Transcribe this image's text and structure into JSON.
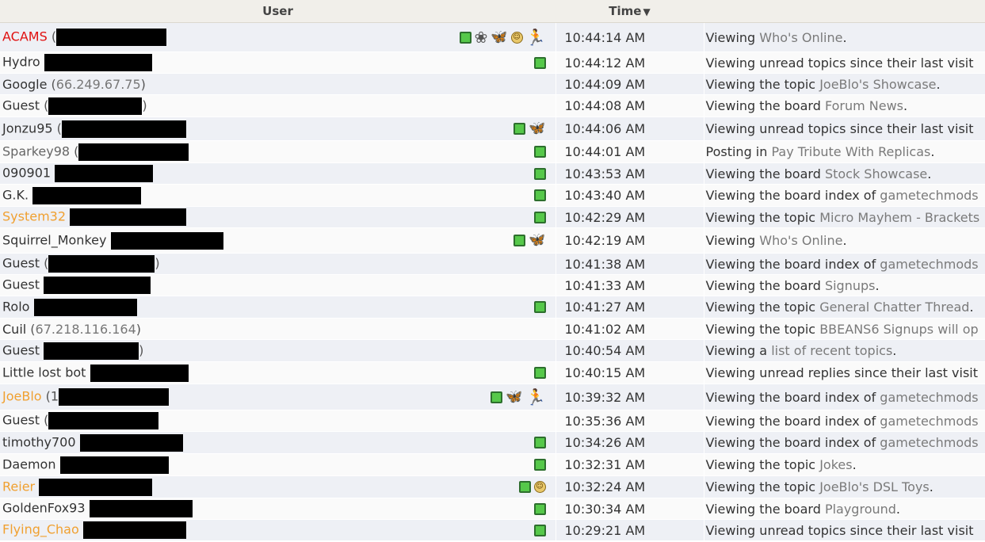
{
  "header": {
    "user": "User",
    "time": "Time",
    "sort_arrow": "▼"
  },
  "rows": [
    {
      "name": "ACAMS",
      "role": "admin",
      "paren": "(",
      "ip": "",
      "close": "",
      "redact_w": 139,
      "icons": [
        "online",
        "flower",
        "butterfly",
        "smile",
        "aim"
      ],
      "time": "10:44:14 AM",
      "verb": "Viewing ",
      "link": "Who's Online",
      "tail": ".",
      "h": 37
    },
    {
      "name": "Hydro",
      "role": "",
      "paren": "",
      "ip": "",
      "close": "",
      "redact_w": 136,
      "icons": [
        "online"
      ],
      "time": "10:44:12 AM",
      "verb": "Viewing unread topics since their last visit",
      "link": "",
      "tail": "",
      "h": 27
    },
    {
      "name": "Google",
      "role": "",
      "paren": "(",
      "ip": "66.249.67.75",
      "close": ")",
      "redact_w": 0,
      "icons": [],
      "time": "10:44:09 AM",
      "verb": "Viewing the topic ",
      "link": "JoeBlo's Showcase",
      "tail": ".",
      "h": 27
    },
    {
      "name": "Guest",
      "role": "",
      "paren": "(",
      "ip": "",
      "close": ")",
      "redact_w": 118,
      "icons": [],
      "time": "10:44:08 AM",
      "verb": "Viewing the board ",
      "link": "Forum News",
      "tail": ".",
      "h": 28
    },
    {
      "name": "Jonzu95",
      "role": "",
      "paren": "(",
      "ip": "",
      "close": "",
      "redact_w": 157,
      "icons": [
        "online",
        "butterfly"
      ],
      "time": "10:44:06 AM",
      "verb": "Viewing unread topics since their last visit",
      "link": "",
      "tail": "",
      "h": 30
    },
    {
      "name": "Sparkey98",
      "role": "muted",
      "paren": "(",
      "ip": "",
      "close": "",
      "redact_w": 139,
      "icons": [
        "online"
      ],
      "time": "10:44:01 AM",
      "verb": "Posting in ",
      "link": "Pay Tribute With Replicas",
      "tail": ".",
      "h": 28
    },
    {
      "name": "090901",
      "role": "",
      "paren": "",
      "ip": "",
      "close": "",
      "redact_w": 124,
      "icons": [
        "online"
      ],
      "time": "10:43:53 AM",
      "verb": "Viewing the board ",
      "link": "Stock Showcase",
      "tail": ".",
      "h": 27
    },
    {
      "name": "G.K.",
      "role": "",
      "paren": "",
      "ip": "",
      "close": "",
      "redact_w": 137,
      "icons": [
        "online"
      ],
      "time": "10:43:40 AM",
      "verb": "Viewing the board index of ",
      "link": "gametechmods",
      "tail": "",
      "h": 28
    },
    {
      "name": "System32",
      "role": "mod",
      "paren": "",
      "ip": "",
      "close": "",
      "redact_w": 147,
      "icons": [
        "online"
      ],
      "time": "10:42:29 AM",
      "verb": "Viewing the topic ",
      "link": "Micro Mayhem - Brackets",
      "tail": "",
      "h": 27
    },
    {
      "name": "Squirrel_Monkey",
      "role": "",
      "paren": "",
      "ip": "",
      "close": "",
      "redact_w": 142,
      "icons": [
        "online",
        "butterfly"
      ],
      "time": "10:42:19 AM",
      "verb": "Viewing ",
      "link": "Who's Online",
      "tail": ".",
      "h": 32
    },
    {
      "name": "Guest",
      "role": "",
      "paren": "(",
      "ip": "",
      "close": ")",
      "redact_w": 134,
      "icons": [],
      "time": "10:41:38 AM",
      "verb": "Viewing the board index of ",
      "link": "gametechmods",
      "tail": "",
      "h": 27
    },
    {
      "name": "Guest",
      "role": "",
      "paren": "",
      "ip": "",
      "close": "",
      "redact_w": 135,
      "icons": [],
      "time": "10:41:33 AM",
      "verb": "Viewing the board ",
      "link": "Signups",
      "tail": ".",
      "h": 27
    },
    {
      "name": "Rolo",
      "role": "",
      "paren": "",
      "ip": "",
      "close": "",
      "redact_w": 130,
      "icons": [
        "online"
      ],
      "time": "10:41:27 AM",
      "verb": "Viewing the topic ",
      "link": "General Chatter Thread",
      "tail": ".",
      "h": 28
    },
    {
      "name": "Cuil",
      "role": "",
      "paren": "(",
      "ip": "67.218.116.164",
      "close": ")",
      "redact_w": 0,
      "icons": [],
      "time": "10:41:02 AM",
      "verb": "Viewing the topic ",
      "link": "BBEANS6 Signups will op",
      "tail": "",
      "h": 27
    },
    {
      "name": "Guest",
      "role": "",
      "paren": "",
      "ip": "",
      "close": ")",
      "redact_w": 120,
      "icons": [],
      "time": "10:40:54 AM",
      "verb": "Viewing a ",
      "link": "list of recent topics",
      "tail": ".",
      "h": 28
    },
    {
      "name": "Little lost bot",
      "role": "",
      "paren": "",
      "ip": "",
      "close": "",
      "redact_w": 124,
      "icons": [
        "online"
      ],
      "time": "10:40:15 AM",
      "verb": "Viewing unread replies since their last visit",
      "link": "",
      "tail": "",
      "h": 28
    },
    {
      "name": "JoeBlo",
      "role": "mod",
      "paren": "(1",
      "ip": "",
      "close": "",
      "redact_w": 139,
      "icons": [
        "online",
        "butterfly",
        "aim"
      ],
      "time": "10:39:32 AM",
      "verb": "Viewing the board index of ",
      "link": "gametechmods",
      "tail": "",
      "h": 33
    },
    {
      "name": "Guest",
      "role": "",
      "paren": "(",
      "ip": "",
      "close": "",
      "redact_w": 139,
      "icons": [],
      "time": "10:35:36 AM",
      "verb": "Viewing the board index of ",
      "link": "gametechmods",
      "tail": "",
      "h": 27
    },
    {
      "name": "timothy700",
      "role": "",
      "paren": "",
      "ip": "",
      "close": "",
      "redact_w": 130,
      "icons": [
        "online"
      ],
      "time": "10:34:26 AM",
      "verb": "Viewing the board index of ",
      "link": "gametechmods",
      "tail": "",
      "h": 28
    },
    {
      "name": "Daemon",
      "role": "",
      "paren": "",
      "ip": "",
      "close": "",
      "redact_w": 137,
      "icons": [
        "online"
      ],
      "time": "10:32:31 AM",
      "verb": "Viewing the topic ",
      "link": "Jokes",
      "tail": ".",
      "h": 28
    },
    {
      "name": "Reier",
      "role": "mod",
      "paren": "",
      "ip": "",
      "close": "",
      "redact_w": 143,
      "icons": [
        "online",
        "smile"
      ],
      "time": "10:32:24 AM",
      "verb": "Viewing the topic ",
      "link": "JoeBlo's DSL Toys",
      "tail": ".",
      "h": 28
    },
    {
      "name": "GoldenFox93",
      "role": "",
      "paren": "",
      "ip": "",
      "close": "",
      "redact_w": 130,
      "icons": [
        "online"
      ],
      "time": "10:30:34 AM",
      "verb": "Viewing the board ",
      "link": "Playground",
      "tail": ".",
      "h": 27
    },
    {
      "name": "Flying_Chao",
      "role": "mod",
      "paren": "",
      "ip": "",
      "close": "",
      "redact_w": 130,
      "icons": [
        "online"
      ],
      "time": "10:29:21 AM",
      "verb": "Viewing unread topics since their last visit",
      "link": "",
      "tail": "",
      "h": 27
    }
  ]
}
